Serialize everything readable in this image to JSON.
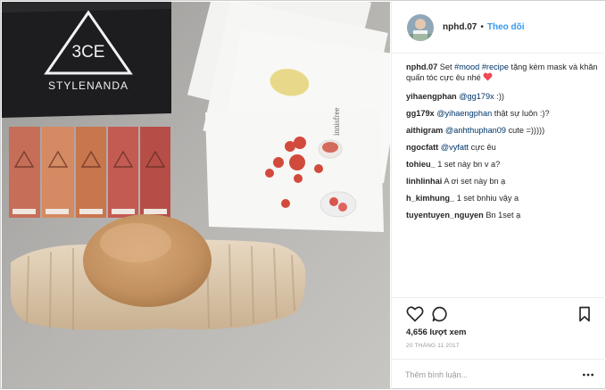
{
  "post": {
    "username": "nphd.07",
    "follow_label": "Theo dõi",
    "caption_user": "nphd.07",
    "caption_pre": "Set",
    "caption_tag1": "#mood",
    "caption_tag2": "#recipe",
    "caption_post": "tặng kèm mask và khăn quấn tóc cực êu nhé",
    "comments": [
      {
        "user": "yihaengphan",
        "mention": "@gg179x",
        "text": ":))"
      },
      {
        "user": "gg179x",
        "mention": "@yihaengphan",
        "text": "thật sự luôn :)?"
      },
      {
        "user": "aithigram",
        "mention": "@anhthuphan09",
        "text": "cute =)))))"
      },
      {
        "user": "ngocfatt",
        "mention": "@vyfatt",
        "text": "cực êu"
      },
      {
        "user": "tohieu_",
        "text": "1 set này bn v a?"
      },
      {
        "user": "linhlinhai",
        "text": "A ơi set này bn ạ"
      },
      {
        "user": "h_kimhung_",
        "text": "1 set bnhiu vậy a"
      },
      {
        "user": "tuyentuyen_nguyen",
        "text": "Bn 1set ạ"
      }
    ],
    "likes": "4,656 lượt xem",
    "date": "20 THÁNG 11 2017",
    "comment_placeholder": "Thêm bình luận...",
    "photo": {
      "brand_text": "STYLENANDA",
      "logo_text": "3CE",
      "mask_brand": "innisfree"
    },
    "icons": [
      "heart-icon",
      "comment-icon",
      "bookmark-icon",
      "more-options-icon"
    ],
    "colors": {
      "link": "#3897f0",
      "tag": "#003569",
      "heart": "#ed4956"
    }
  }
}
